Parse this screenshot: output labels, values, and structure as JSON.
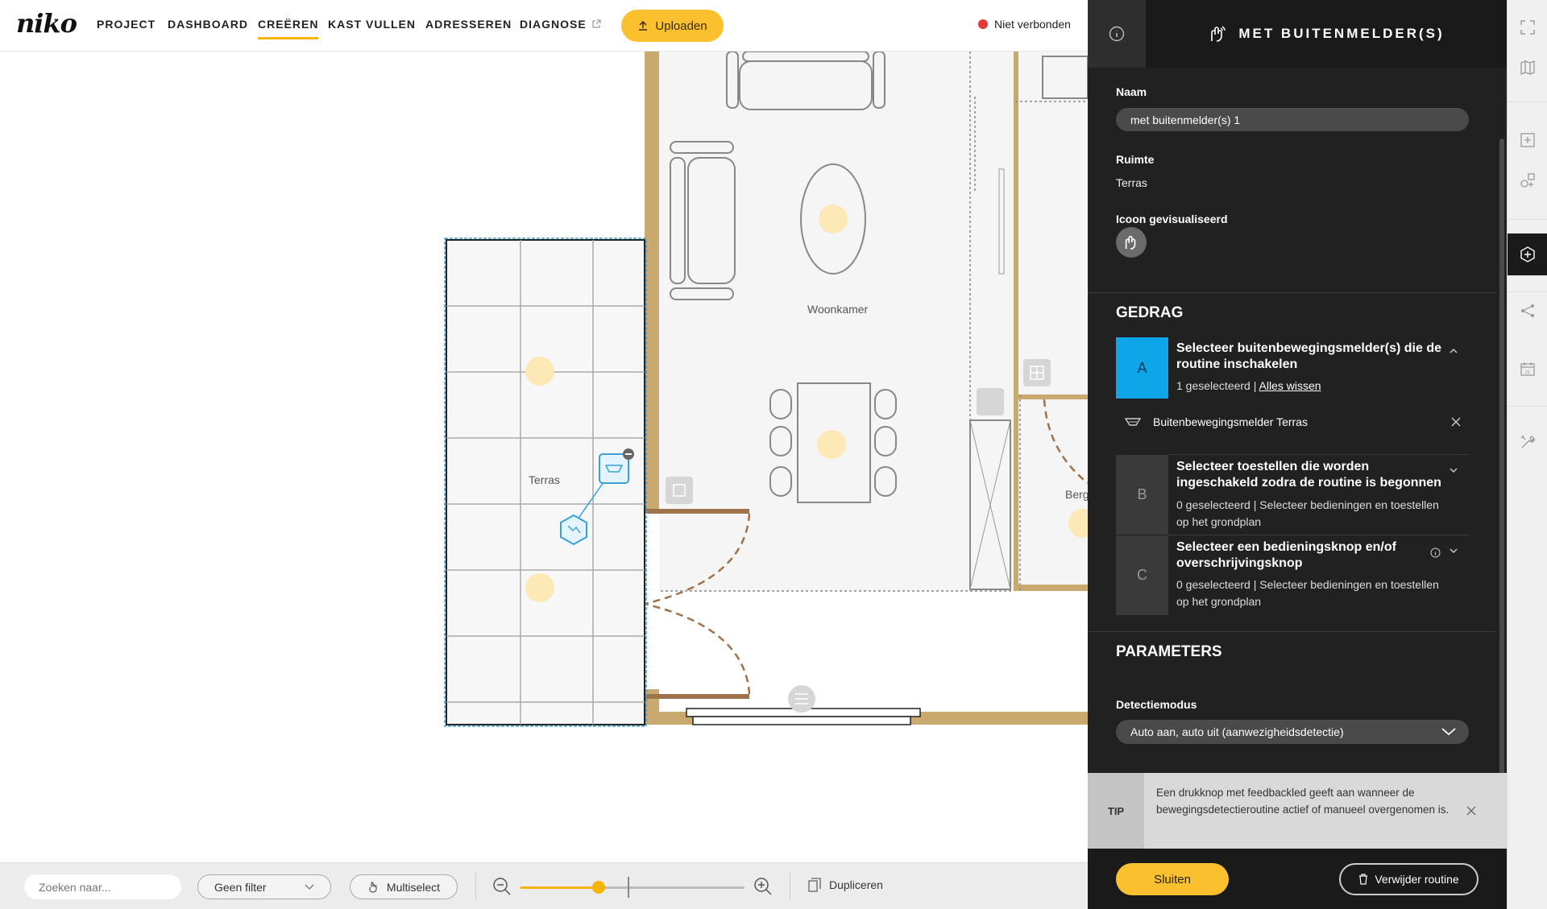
{
  "brand": {
    "logo": "niko",
    "accent": "#fbc02d"
  },
  "nav": {
    "items": [
      "PROJECT",
      "DASHBOARD",
      "CREËREN",
      "KAST VULLEN",
      "ADRESSEREN",
      "DIAGNOSE"
    ],
    "active": "CREËREN",
    "upload_label": "Uploaden",
    "connection_status": "Niet verbonden",
    "connection_color": "#e53935"
  },
  "floorplan": {
    "rooms": [
      "Woonkamer",
      "Terras",
      "Berg"
    ]
  },
  "bottombar": {
    "search_placeholder": "Zoeken naar...",
    "filter_label": "Geen filter",
    "multiselect_label": "Multiselect",
    "duplicate_label": "Dupliceren",
    "zoom_level_fraction": 0.35
  },
  "panel": {
    "title": "MET BUITENMELDER(S)",
    "name_label": "Naam",
    "name_value": "met buitenmelder(s) 1",
    "room_label": "Ruimte",
    "room_value": "Terras",
    "icon_label": "Icoon gevisualiseerd",
    "behavior_heading": "GEDRAG",
    "steps": [
      {
        "letter": "A",
        "title": "Selecteer buitenbewegingsmelder(s) die de routine inschakelen",
        "count": "1 geselecteerd |",
        "action": "Alles wissen",
        "device": "Buitenbewegingsmelder Terras"
      },
      {
        "letter": "B",
        "title": "Selecteer toestellen die worden ingeschakeld zodra de routine is begonnen",
        "count": "0 geselecteerd | Selecteer bedieningen en toestellen op het grondplan"
      },
      {
        "letter": "C",
        "title": "Selecteer een bedieningsknop en/of overschrijvingsknop",
        "count": "0 geselecteerd | Selecteer bedieningen en toestellen op het grondplan"
      }
    ],
    "parameters_heading": "PARAMETERS",
    "detection_label": "Detectiemodus",
    "detection_value": "Auto aan, auto uit (aanwezigheidsdetectie)",
    "tip_label": "TIP",
    "tip_text": "Een drukknop met feedbackled geeft aan wanneer de bewegingsdetectieroutine actief of manueel overgenomen is.",
    "close_label": "Sluiten",
    "delete_label": "Verwijder routine"
  }
}
